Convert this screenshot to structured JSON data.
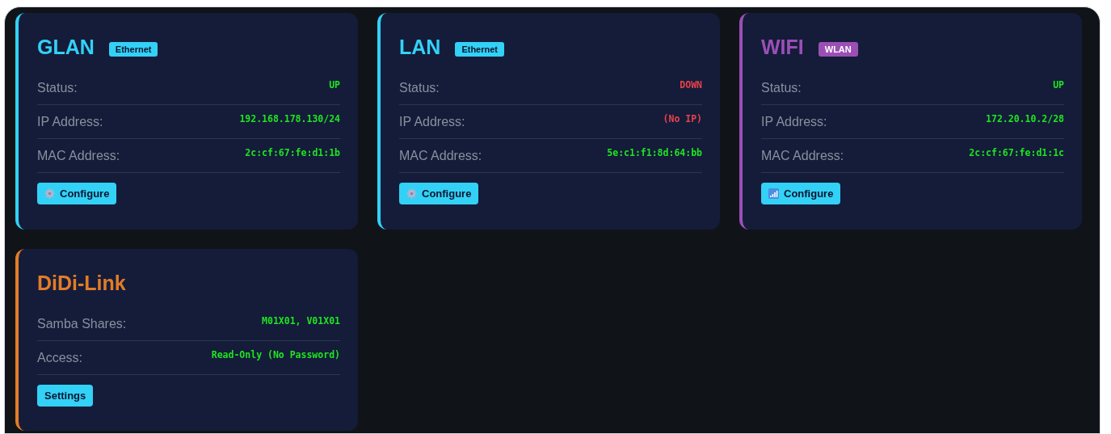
{
  "cards": [
    {
      "title": "GLAN",
      "color": "#33d1f6",
      "badge": "Ethernet",
      "rows": [
        {
          "label": "Status:",
          "value": "UP",
          "error": false
        },
        {
          "label": "IP Address:",
          "value": "192.168.178.130/24",
          "error": false
        },
        {
          "label": "MAC Address:",
          "value": "2c:cf:67:fe:d1:1b",
          "error": false
        }
      ],
      "button": {
        "label": "Configure",
        "kind": "gear"
      }
    },
    {
      "title": "LAN",
      "color": "#33d1f6",
      "badge": "Ethernet",
      "rows": [
        {
          "label": "Status:",
          "value": "DOWN",
          "error": true
        },
        {
          "label": "IP Address:",
          "value": "(No IP)",
          "error": true
        },
        {
          "label": "MAC Address:",
          "value": "5e:c1:f1:8d:64:bb",
          "error": false
        }
      ],
      "button": {
        "label": "Configure",
        "kind": "gear"
      }
    },
    {
      "title": "WIFI",
      "color": "#9b4fb5",
      "badge": "WLAN",
      "rows": [
        {
          "label": "Status:",
          "value": "UP",
          "error": false
        },
        {
          "label": "IP Address:",
          "value": "172.20.10.2/28",
          "error": false
        },
        {
          "label": "MAC Address:",
          "value": "2c:cf:67:fe:d1:1c",
          "error": false
        }
      ],
      "button": {
        "label": "Configure",
        "kind": "signal"
      }
    },
    {
      "title": "DiDi-Link",
      "color": "#e37c27",
      "rows": [
        {
          "label": "Samba Shares:",
          "value": "M01X01, V01X01",
          "error": false
        },
        {
          "label": "Access:",
          "value": "Read-Only (No Password)",
          "error": false
        }
      ],
      "button": {
        "label": "Settings",
        "kind": "plain"
      }
    }
  ]
}
